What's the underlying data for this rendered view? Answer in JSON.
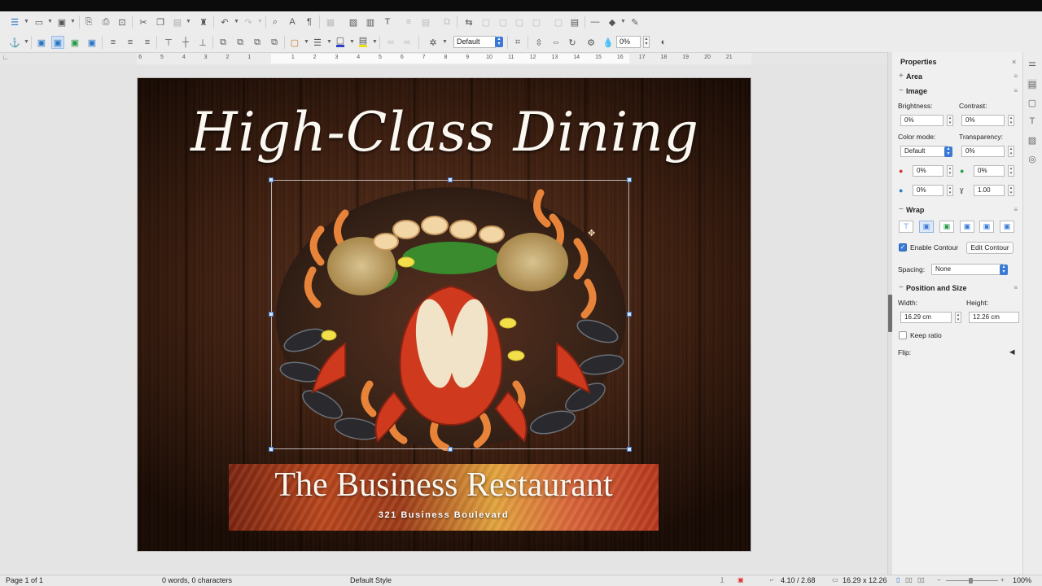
{
  "toolbar": {
    "image_mode_value": "Default",
    "transparency_value": "0%"
  },
  "ruler": {
    "left_numbers": [
      "6",
      "5",
      "4",
      "3",
      "2",
      "1"
    ],
    "right_numbers": [
      "1",
      "2",
      "3",
      "4",
      "5",
      "6",
      "7",
      "8",
      "9",
      "10",
      "11",
      "12",
      "13",
      "14",
      "15",
      "16",
      "17",
      "18",
      "19",
      "20",
      "21"
    ]
  },
  "slide": {
    "title": "High-Class Dining",
    "banner_title": "The Business Restaurant",
    "banner_subtitle": "321 Business Boulevard"
  },
  "sidebar": {
    "title": "Properties",
    "area_label": "Area",
    "image": {
      "label": "Image",
      "brightness_label": "Brightness:",
      "brightness_value": "0%",
      "contrast_label": "Contrast:",
      "contrast_value": "0%",
      "color_mode_label": "Color mode:",
      "color_mode_value": "Default",
      "transparency_label": "Transparency:",
      "transparency_value": "0%",
      "red_value": "0%",
      "green_value": "0%",
      "blue_value": "0%",
      "gamma_value": "1.00"
    },
    "wrap": {
      "label": "Wrap",
      "enable_contour_label": "Enable Contour",
      "enable_contour_checked": true,
      "edit_contour_label": "Edit Contour",
      "spacing_label": "Spacing:",
      "spacing_value": "None"
    },
    "position_size": {
      "label": "Position and Size",
      "width_label": "Width:",
      "width_value": "16.29 cm",
      "height_label": "Height:",
      "height_value": "12.26 cm",
      "keep_ratio_label": "Keep ratio",
      "flip_label": "Flip:"
    }
  },
  "status": {
    "page": "Page 1 of 1",
    "words": "0 words, 0 characters",
    "page_style": "Default Style",
    "position": "4.10 / 2.68",
    "size": "16.29 x 12.26",
    "zoom": "100%"
  }
}
